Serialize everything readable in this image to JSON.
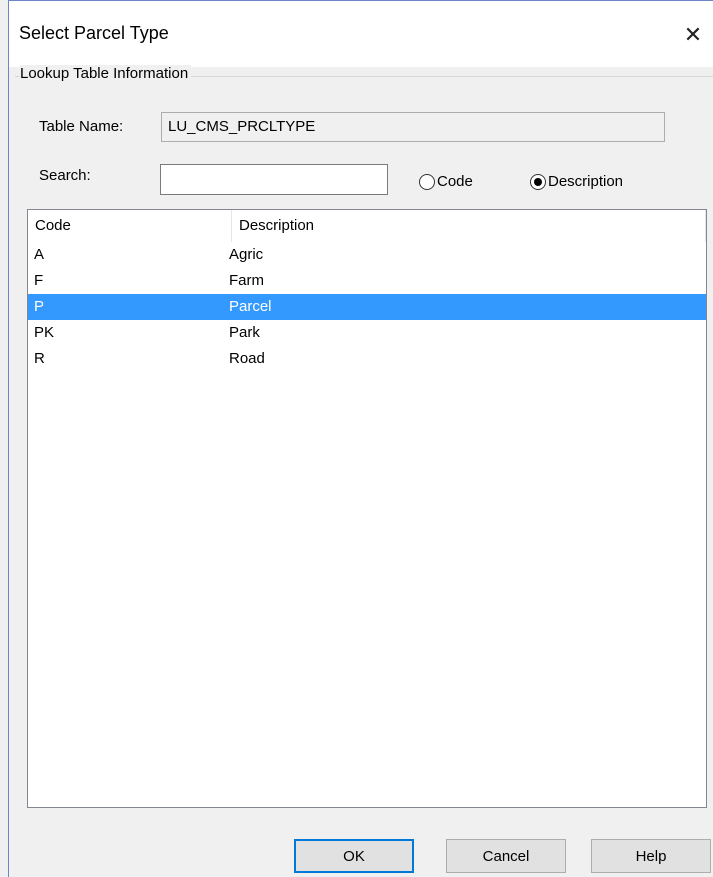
{
  "window": {
    "title": "Select Parcel Type",
    "close_glyph": "✕"
  },
  "group": {
    "legend": "Lookup Table Information"
  },
  "table_name": {
    "label": "Table Name:",
    "value": "LU_CMS_PRCLTYPE"
  },
  "search": {
    "label": "Search:",
    "value": "",
    "placeholder": ""
  },
  "search_mode": {
    "options": [
      {
        "label": "Code",
        "checked": false
      },
      {
        "label": "Description",
        "checked": true
      }
    ]
  },
  "list": {
    "columns": [
      "Code",
      "Description"
    ],
    "rows": [
      {
        "code": "A",
        "description": "Agric",
        "selected": false
      },
      {
        "code": "F",
        "description": "Farm",
        "selected": false
      },
      {
        "code": "P",
        "description": "Parcel",
        "selected": true
      },
      {
        "code": "PK",
        "description": "Park",
        "selected": false
      },
      {
        "code": "R",
        "description": "Road",
        "selected": false
      }
    ]
  },
  "buttons": {
    "ok": "OK",
    "cancel": "Cancel",
    "help": "Help"
  },
  "colors": {
    "selection": "#3399ff",
    "default_button_border": "#0078d7"
  }
}
